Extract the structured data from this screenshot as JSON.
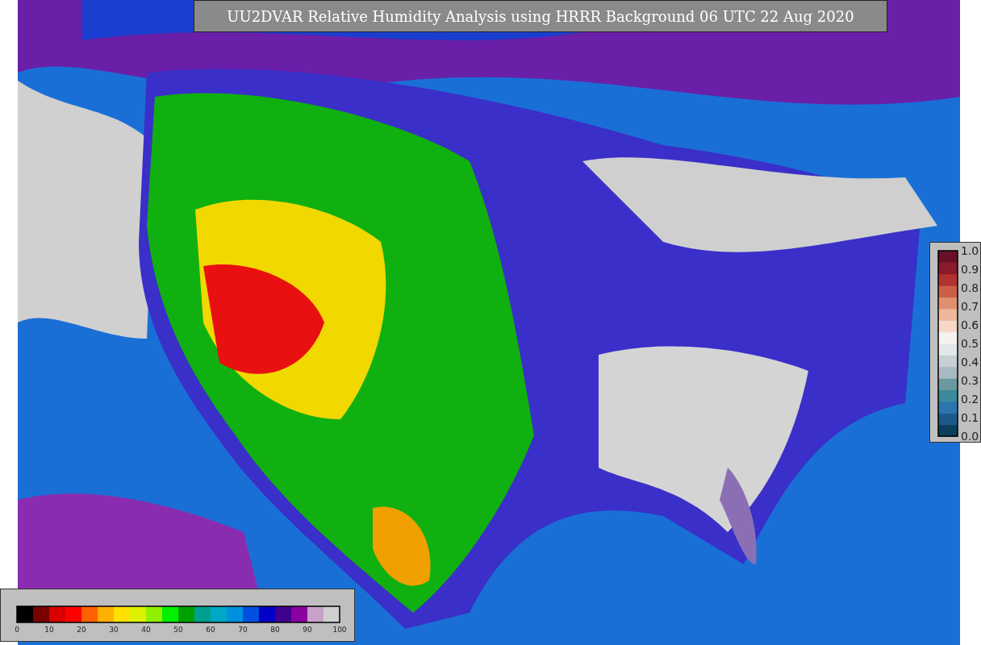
{
  "title": "UU2DVAR Relative Humidity Analysis using HRRR Background 06 UTC 22 Aug 2020",
  "colorbars": [
    {
      "kind": "vertical",
      "ticks": [
        "1.0",
        "0.9",
        "0.8",
        "0.7",
        "0.6",
        "0.5",
        "0.4",
        "0.3",
        "0.2",
        "0.1",
        "0.0"
      ]
    },
    {
      "kind": "horizontal",
      "ticks": [
        "0",
        "10",
        "20",
        "30",
        "40",
        "50",
        "60",
        "70",
        "80",
        "90",
        "100"
      ]
    }
  ]
}
